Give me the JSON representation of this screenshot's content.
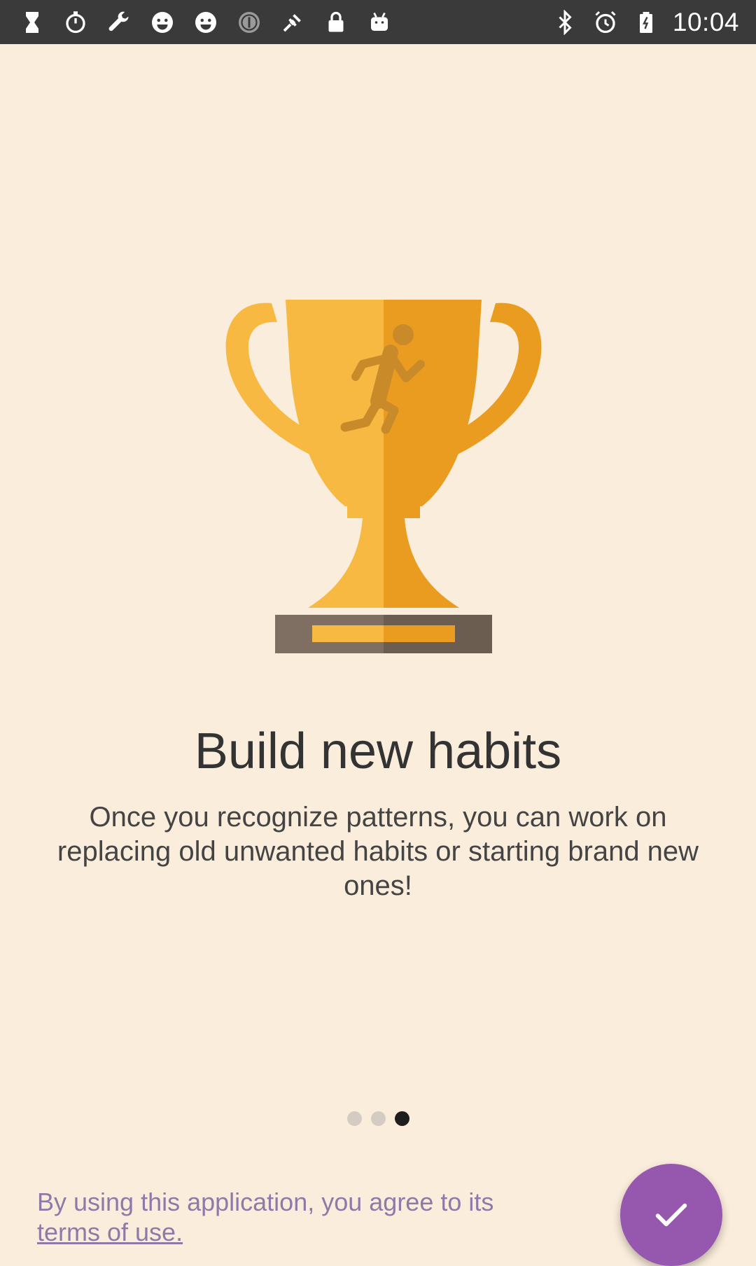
{
  "status_bar": {
    "left_icons": [
      "hourglass-icon",
      "stopwatch-icon",
      "wrench-icon",
      "smiley-icon",
      "smiley-icon",
      "circle-info-icon",
      "fake-gps-icon",
      "lock-icon",
      "android-icon"
    ],
    "right_icons": [
      "bluetooth-icon",
      "alarm-icon",
      "battery-icon"
    ],
    "time": "10:04"
  },
  "onboarding": {
    "title": "Build new habits",
    "description": "Once you recognize patterns, you can work on replacing old unwanted habits or starting brand new ones!",
    "page_indicator": {
      "total": 3,
      "current": 3
    },
    "illustration": "trophy-icon"
  },
  "footer": {
    "terms_prefix": "By using this application, you agree to its",
    "terms_link": "terms of use.",
    "confirm_icon": "checkmark-icon"
  },
  "colors": {
    "background": "#FBEDDC",
    "status_bar": "#3A3A3A",
    "accent": "#9558AE",
    "terms_text": "#8E7AA8",
    "trophy_light": "#F7B942",
    "trophy_dark": "#E99C1F",
    "base": "#7E6F62"
  }
}
